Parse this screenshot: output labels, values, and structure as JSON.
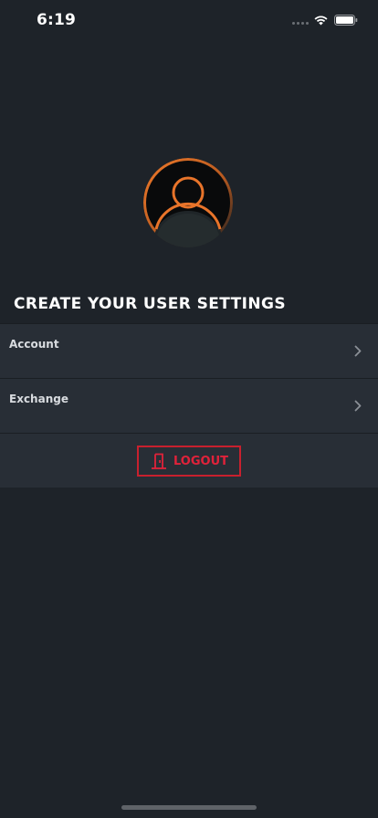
{
  "status_bar": {
    "time": "6:19"
  },
  "profile": {
    "avatar_icon": "user-avatar-icon"
  },
  "page_title": "CREATE YOUR USER SETTINGS",
  "settings": {
    "items": [
      {
        "label": "Account",
        "icon": "chevron-right-icon"
      },
      {
        "label": "Exchange",
        "icon": "chevron-right-icon"
      }
    ]
  },
  "logout": {
    "label": "LOGOUT",
    "icon": "door-exit-icon"
  },
  "colors": {
    "background": "#1e2329",
    "row_background": "#282e36",
    "accent_orange": "#e8742a",
    "logout_red": "#c8202e"
  }
}
